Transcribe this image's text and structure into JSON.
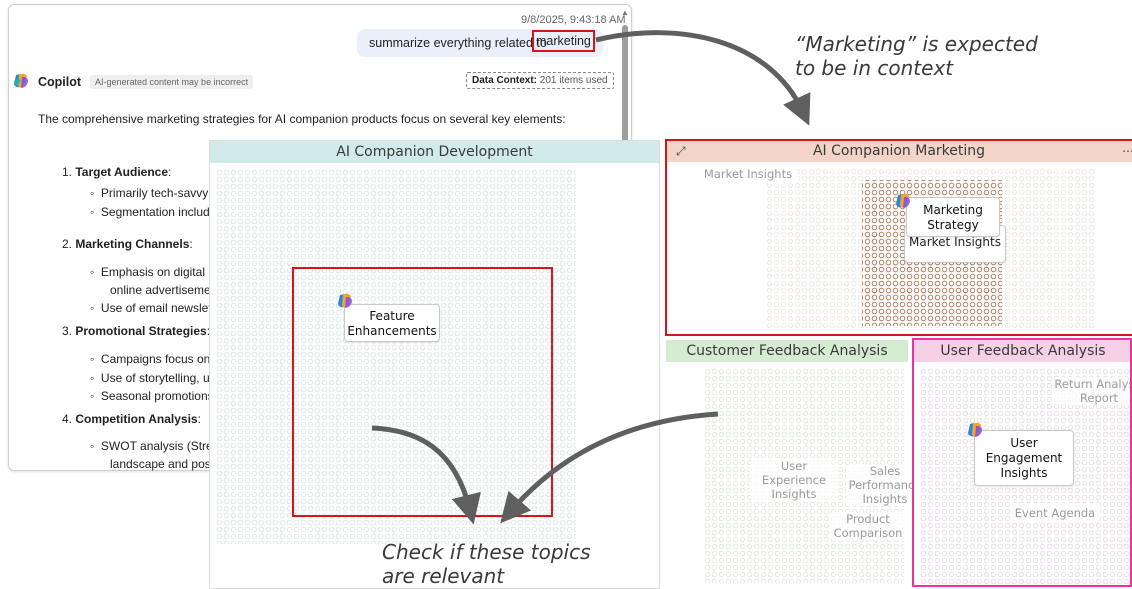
{
  "chat": {
    "timestamp": "9/8/2025, 9:43:18 AM",
    "user_message_prefix": "summarize everything related to ",
    "user_message_keyword": "marketing",
    "assistant_name": "Copilot",
    "disclaimer": "AI-generated content may be incorrect",
    "context_label": "Data Context:",
    "context_value": "201 items used",
    "intro": "The comprehensive marketing strategies for AI companion products focus on several key elements:",
    "sections": [
      {
        "num": "1. ",
        "title": "Target Audience",
        "bullets": [
          "Primarily tech-savvy",
          "Segmentation includ"
        ]
      },
      {
        "num": "2. ",
        "title": "Marketing Channels",
        "bullets": [
          "Emphasis on digital r",
          "online advertisement",
          "Use of email newslet"
        ]
      },
      {
        "num": "3. ",
        "title": "Promotional Strategies",
        "bullets": [
          "Campaigns focus on",
          "Use of storytelling, u",
          "Seasonal promotions"
        ]
      },
      {
        "num": "4. ",
        "title": "Competition Analysis",
        "bullets": [
          "SWOT analysis (Strer",
          "landscape and positi"
        ]
      }
    ]
  },
  "panels": {
    "development": {
      "title": "AI Companion Development",
      "card": "Feature\nEnhancements",
      "header_color": "#d3eaea"
    },
    "marketing": {
      "title": "AI Companion Marketing",
      "ghost": "Market Insights",
      "card": "Marketing\nStrategy",
      "card_under": "Market Insights",
      "header_color": "#f2d5c8"
    },
    "customer_feedback": {
      "title": "Customer Feedback Analysis",
      "header_color": "#d5ecd2",
      "ghosts": [
        "User\nExperience\nInsights",
        "Sales\nPerformance\nInsights",
        "Product\nComparison"
      ]
    },
    "user_feedback": {
      "title": "User Feedback Analysis",
      "header_color": "#f6d0e4",
      "card": "User\nEngagement\nInsights",
      "ghosts": [
        "Return Analysis\nReport",
        "Event Agenda"
      ]
    }
  },
  "annotations": {
    "top": "“Marketing” is expected\nto be in context",
    "bottom": "Check if these topics\nare relevant"
  },
  "colors": {
    "highlight_red": "#d8141b",
    "arrow_gray": "#5f5f5f"
  }
}
